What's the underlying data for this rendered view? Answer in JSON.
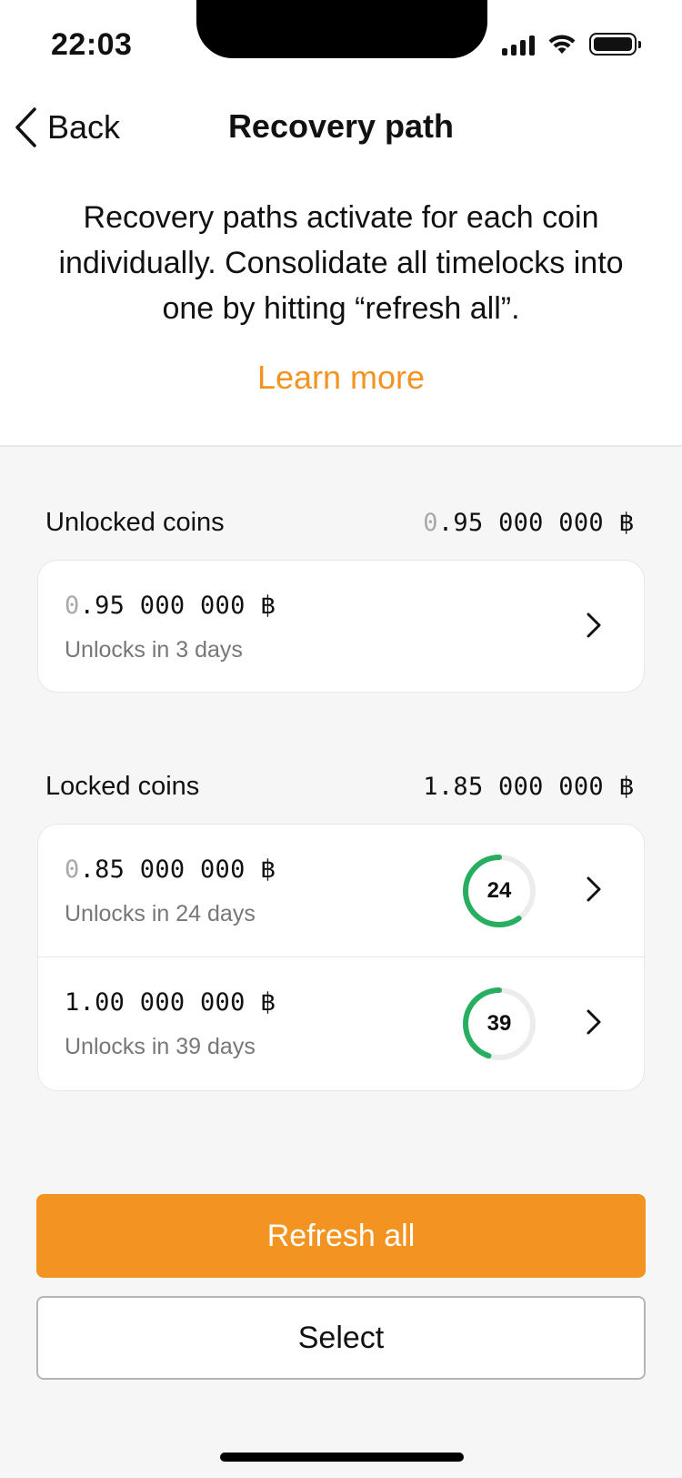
{
  "status_bar": {
    "time": "22:03"
  },
  "nav": {
    "back_label": "Back",
    "title": "Recovery path"
  },
  "intro": {
    "description": "Recovery paths activate for each coin individually. Consolidate all timelocks into one by hitting “refresh all”.",
    "learn_more": "Learn more"
  },
  "unlocked": {
    "title": "Unlocked coins",
    "total": {
      "lead": "0",
      "rest": ".95 000 000 ",
      "symbol": "฿"
    },
    "items": [
      {
        "amount": {
          "lead": "0",
          "rest": ".95 000 000 ",
          "symbol": "฿"
        },
        "subtitle": "Unlocks in 3 days"
      }
    ]
  },
  "locked": {
    "title": "Locked coins",
    "total": {
      "lead": "",
      "rest": "1.85 000 000 ",
      "symbol": "฿"
    },
    "items": [
      {
        "amount": {
          "lead": "0",
          "rest": ".85 000 000 ",
          "symbol": "฿"
        },
        "subtitle": "Unlocks in 24 days",
        "days": "24",
        "progress": 0.6
      },
      {
        "amount": {
          "lead": "",
          "rest": "1.00 000 000 ",
          "symbol": "฿"
        },
        "subtitle": "Unlocks in 39 days",
        "days": "39",
        "progress": 0.45
      }
    ]
  },
  "actions": {
    "refresh_all": "Refresh all",
    "select": "Select"
  },
  "colors": {
    "accent": "#f39422",
    "progress": "#27ae60",
    "track": "#ececec"
  },
  "icons": {
    "back": "chevron-left-icon",
    "row": "chevron-right-icon"
  }
}
